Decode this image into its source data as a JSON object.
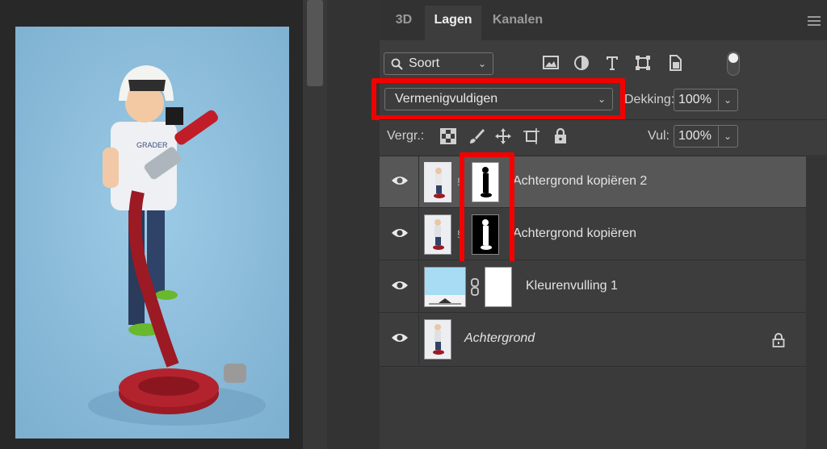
{
  "tabs": [
    {
      "label": "3D",
      "active": false
    },
    {
      "label": "Lagen",
      "active": true
    },
    {
      "label": "Kanalen",
      "active": false
    }
  ],
  "filter": {
    "label": "Soort",
    "icon": "search-icon"
  },
  "filter_icons": [
    "image-filter-icon",
    "adjustment-filter-icon",
    "type-filter-icon",
    "shape-filter-icon",
    "smart-object-filter-icon",
    "filter-toggle-switch"
  ],
  "blend": {
    "mode": "Vermenigvuldigen",
    "opacity_label": "Dekking:",
    "opacity_value": "100%"
  },
  "lock": {
    "label": "Vergr.:",
    "icons": [
      "lock-transparent-pixels-icon",
      "lock-image-pixels-icon",
      "lock-position-icon",
      "lock-artboard-icon",
      "lock-all-icon"
    ]
  },
  "fill": {
    "label": "Vul:",
    "value": "100%"
  },
  "layers": [
    {
      "name": "Achtergrond kopiëren 2",
      "selected": true,
      "has_mask": true,
      "mask": "white-bg-black-silhouette",
      "italic": false
    },
    {
      "name": "Achtergrond kopiëren",
      "selected": false,
      "has_mask": true,
      "mask": "black-bg-white-silhouette",
      "italic": false
    },
    {
      "name": "Kleurenvulling 1",
      "selected": false,
      "has_mask": true,
      "mask": "white",
      "italic": false,
      "fill_color": "#a8dcf5"
    },
    {
      "name": "Achtergrond",
      "selected": false,
      "has_mask": false,
      "italic": true,
      "locked": true
    }
  ],
  "colors": {
    "highlight": "#f20000",
    "panel": "#3d3d3d",
    "selected_row": "#575757",
    "photo_bg": "#8bbad8"
  }
}
